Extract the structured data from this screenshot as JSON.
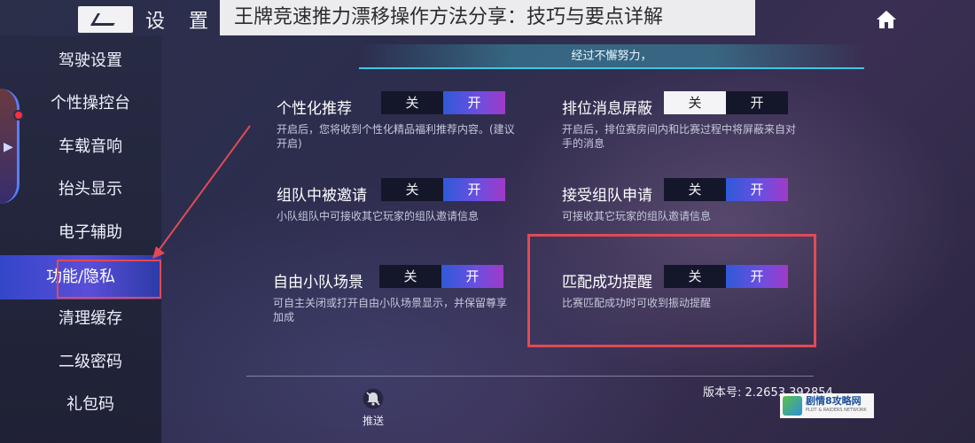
{
  "topbar": {
    "settings_title": "设 置",
    "article_title": "王牌竞速推力漂移操作方法分享：技巧与要点详解"
  },
  "sidebar": {
    "items": [
      {
        "label": "驾驶设置"
      },
      {
        "label": "个性操控台"
      },
      {
        "label": "车载音响"
      },
      {
        "label": "抬头显示"
      },
      {
        "label": "电子辅助"
      },
      {
        "label": "功能/隐私"
      },
      {
        "label": "清理缓存"
      },
      {
        "label": "二级密码"
      },
      {
        "label": "礼包码"
      }
    ],
    "active_index": 5
  },
  "promo_text": "经过不懈努力，",
  "toggle_labels": {
    "off": "关",
    "on": "开"
  },
  "settings": [
    {
      "label": "个性化推荐",
      "desc": "开启后，您将收到个性化精品福利推荐内容。(建议开启)",
      "state": "on"
    },
    {
      "label": "排位消息屏蔽",
      "desc": "开启后，排位赛房间内和比赛过程中将屏蔽来自对手的消息",
      "state": "off"
    },
    {
      "label": "组队中被邀请",
      "desc": "小队组队中可接收其它玩家的组队邀请信息",
      "state": "on"
    },
    {
      "label": "接受组队申请",
      "desc": "可接收其它玩家的组队邀请信息",
      "state": "on"
    },
    {
      "label": "自由小队场景",
      "desc": "可自主关闭或打开自由小队场景显示，并保留尊享加成",
      "state": "on"
    },
    {
      "label": "匹配成功提醒",
      "desc": "比赛匹配成功时可收到振动提醒",
      "state": "on"
    }
  ],
  "footer": {
    "push_label": "推送",
    "version": "版本号: 2.2653.392854"
  },
  "watermark": {
    "main": "剧情8攻略网",
    "sub": "PLOT & RAIDERS NETWORK"
  },
  "colors": {
    "accent_gradient_start": "#2f5ad8",
    "accent_gradient_end": "#a03ac8",
    "highlight": "#e14a55",
    "promo_line": "#3cc8e6"
  }
}
